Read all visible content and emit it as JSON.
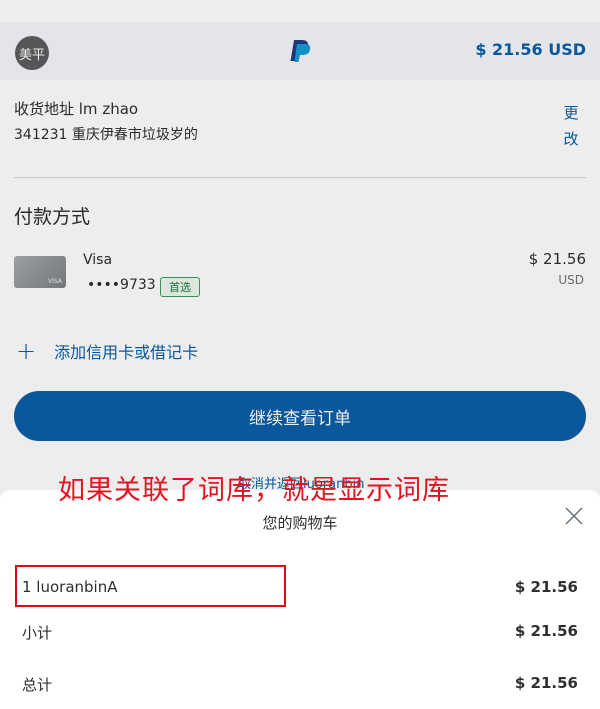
{
  "header": {
    "avatar_text": "美平",
    "logo_icon": "paypal-logo",
    "total": "$ 21.56 USD"
  },
  "shipping": {
    "label": "收货地址 lm zhao",
    "address": "341231 重庆伊春市垃圾岁的",
    "change_line1": "更",
    "change_line2": "改"
  },
  "payment": {
    "title": "付款方式",
    "card_brand": "Visa",
    "card_number": "••••9733",
    "preferred_badge": "首选",
    "amount": "$ 21.56",
    "currency": "USD",
    "card_image_text": "VISA"
  },
  "add_card": {
    "label": "添加信用卡或借记卡",
    "icon": "plus-icon"
  },
  "continue_button": "继续查看订单",
  "cancel_link": "取消并返回luoranbin",
  "annotation": "如果关联了词库，就是显示词库",
  "cart": {
    "title": "您的购物车",
    "close_icon": "close-icon",
    "item_label": "1 luoranbinA",
    "item_value": "$ 21.56",
    "subtotal_label": "小计",
    "subtotal_value": "$ 21.56",
    "total_label": "总计",
    "total_value": "$ 21.56"
  },
  "colors": {
    "accent": "#0b5ea8",
    "annotation": "#e3141f",
    "highlight_border": "#e30914"
  }
}
